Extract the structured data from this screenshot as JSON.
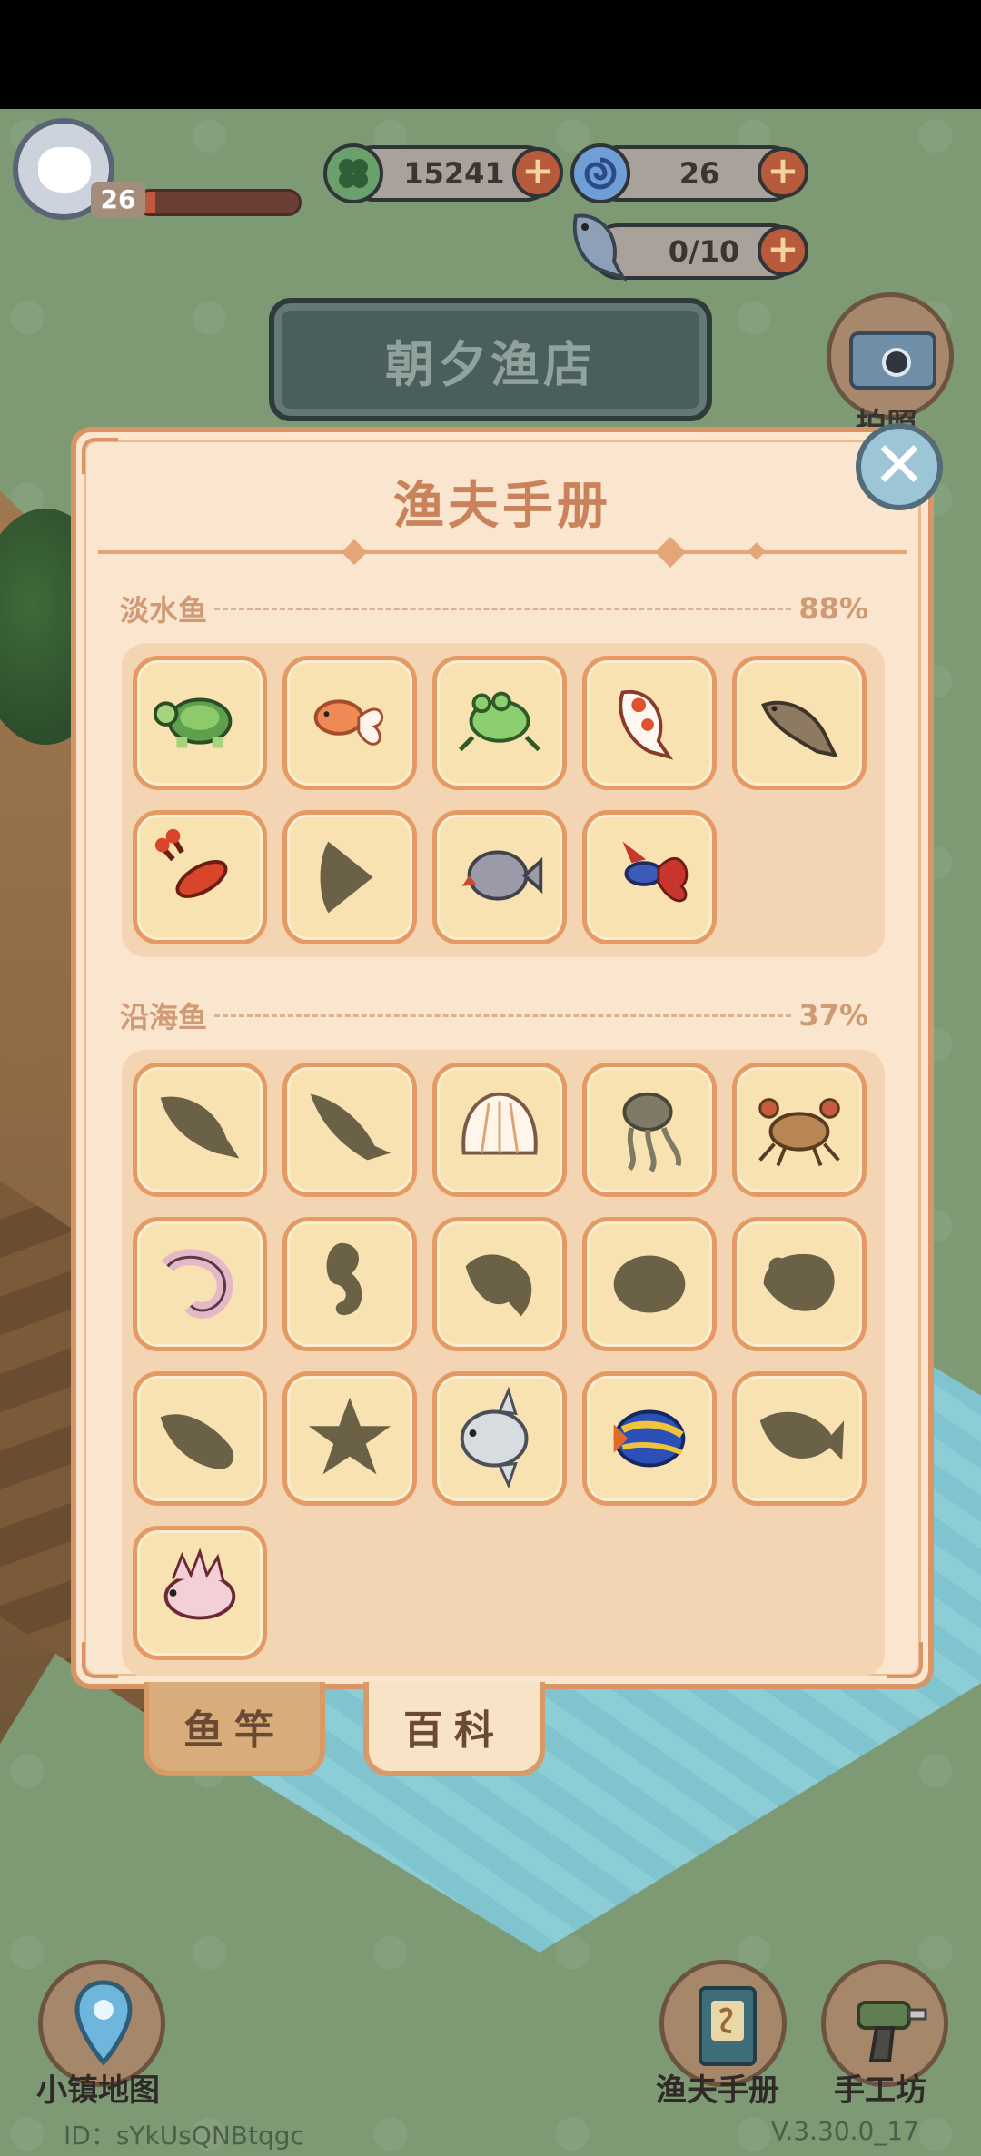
{
  "hud": {
    "level": "26",
    "xp_fraction": 0.1,
    "clover_currency": "15241",
    "swirl_currency": "26",
    "fish_capacity": "0/10",
    "shop_name": "朝夕渔店",
    "camera_label": "拍照"
  },
  "panel": {
    "title": "渔夫手册",
    "sections": [
      {
        "title": "淡水鱼",
        "percent": "88%",
        "items": [
          {
            "name": "turtle",
            "discovered": true
          },
          {
            "name": "goldfish",
            "discovered": true
          },
          {
            "name": "frog",
            "discovered": true
          },
          {
            "name": "koi",
            "discovered": true
          },
          {
            "name": "carp",
            "discovered": true
          },
          {
            "name": "crayfish",
            "discovered": true
          },
          {
            "name": "angelfish",
            "discovered": false
          },
          {
            "name": "piranha",
            "discovered": true
          },
          {
            "name": "betta",
            "discovered": true
          }
        ]
      },
      {
        "title": "沿海鱼",
        "percent": "37%",
        "items": [
          {
            "name": "fish-silhouette-1",
            "discovered": false
          },
          {
            "name": "fish-silhouette-2",
            "discovered": false
          },
          {
            "name": "scallop",
            "discovered": true
          },
          {
            "name": "jellyfish",
            "discovered": false
          },
          {
            "name": "crab",
            "discovered": true
          },
          {
            "name": "shrimp",
            "discovered": true
          },
          {
            "name": "seahorse",
            "discovered": false
          },
          {
            "name": "fish-silhouette-3",
            "discovered": false
          },
          {
            "name": "clam-silhouette",
            "discovered": false
          },
          {
            "name": "conch-silhouette",
            "discovered": false
          },
          {
            "name": "sea-cucumber",
            "discovered": false
          },
          {
            "name": "starfish",
            "discovered": false
          },
          {
            "name": "sunfish",
            "discovered": true
          },
          {
            "name": "emperor-angelfish",
            "discovered": true
          },
          {
            "name": "fish-silhouette-4",
            "discovered": false
          },
          {
            "name": "scorpionfish",
            "discovered": true
          }
        ]
      }
    ]
  },
  "tabs": {
    "rod": "鱼竿",
    "wiki": "百科"
  },
  "nav": {
    "map": "小镇地图",
    "handbook": "渔夫手册",
    "workshop": "手工坊"
  },
  "footer": {
    "id": "ID：sYkUsQNBtqgc",
    "version": "V.3.30.0_17"
  },
  "colors": {
    "panel_bg": "#fae6ce",
    "panel_border": "#d99566",
    "silhouette": "#6a6146",
    "title": "#c9825a"
  }
}
